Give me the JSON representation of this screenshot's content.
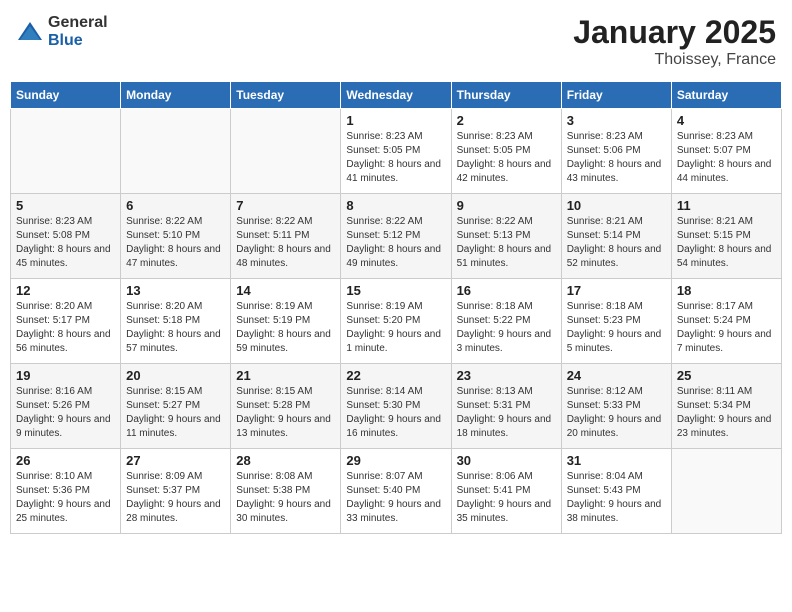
{
  "logo": {
    "general": "General",
    "blue": "Blue"
  },
  "header": {
    "month": "January 2025",
    "location": "Thoissey, France"
  },
  "weekdays": [
    "Sunday",
    "Monday",
    "Tuesday",
    "Wednesday",
    "Thursday",
    "Friday",
    "Saturday"
  ],
  "weeks": [
    [
      {
        "day": "",
        "info": ""
      },
      {
        "day": "",
        "info": ""
      },
      {
        "day": "",
        "info": ""
      },
      {
        "day": "1",
        "info": "Sunrise: 8:23 AM\nSunset: 5:05 PM\nDaylight: 8 hours and 41 minutes."
      },
      {
        "day": "2",
        "info": "Sunrise: 8:23 AM\nSunset: 5:05 PM\nDaylight: 8 hours and 42 minutes."
      },
      {
        "day": "3",
        "info": "Sunrise: 8:23 AM\nSunset: 5:06 PM\nDaylight: 8 hours and 43 minutes."
      },
      {
        "day": "4",
        "info": "Sunrise: 8:23 AM\nSunset: 5:07 PM\nDaylight: 8 hours and 44 minutes."
      }
    ],
    [
      {
        "day": "5",
        "info": "Sunrise: 8:23 AM\nSunset: 5:08 PM\nDaylight: 8 hours and 45 minutes."
      },
      {
        "day": "6",
        "info": "Sunrise: 8:22 AM\nSunset: 5:10 PM\nDaylight: 8 hours and 47 minutes."
      },
      {
        "day": "7",
        "info": "Sunrise: 8:22 AM\nSunset: 5:11 PM\nDaylight: 8 hours and 48 minutes."
      },
      {
        "day": "8",
        "info": "Sunrise: 8:22 AM\nSunset: 5:12 PM\nDaylight: 8 hours and 49 minutes."
      },
      {
        "day": "9",
        "info": "Sunrise: 8:22 AM\nSunset: 5:13 PM\nDaylight: 8 hours and 51 minutes."
      },
      {
        "day": "10",
        "info": "Sunrise: 8:21 AM\nSunset: 5:14 PM\nDaylight: 8 hours and 52 minutes."
      },
      {
        "day": "11",
        "info": "Sunrise: 8:21 AM\nSunset: 5:15 PM\nDaylight: 8 hours and 54 minutes."
      }
    ],
    [
      {
        "day": "12",
        "info": "Sunrise: 8:20 AM\nSunset: 5:17 PM\nDaylight: 8 hours and 56 minutes."
      },
      {
        "day": "13",
        "info": "Sunrise: 8:20 AM\nSunset: 5:18 PM\nDaylight: 8 hours and 57 minutes."
      },
      {
        "day": "14",
        "info": "Sunrise: 8:19 AM\nSunset: 5:19 PM\nDaylight: 8 hours and 59 minutes."
      },
      {
        "day": "15",
        "info": "Sunrise: 8:19 AM\nSunset: 5:20 PM\nDaylight: 9 hours and 1 minute."
      },
      {
        "day": "16",
        "info": "Sunrise: 8:18 AM\nSunset: 5:22 PM\nDaylight: 9 hours and 3 minutes."
      },
      {
        "day": "17",
        "info": "Sunrise: 8:18 AM\nSunset: 5:23 PM\nDaylight: 9 hours and 5 minutes."
      },
      {
        "day": "18",
        "info": "Sunrise: 8:17 AM\nSunset: 5:24 PM\nDaylight: 9 hours and 7 minutes."
      }
    ],
    [
      {
        "day": "19",
        "info": "Sunrise: 8:16 AM\nSunset: 5:26 PM\nDaylight: 9 hours and 9 minutes."
      },
      {
        "day": "20",
        "info": "Sunrise: 8:15 AM\nSunset: 5:27 PM\nDaylight: 9 hours and 11 minutes."
      },
      {
        "day": "21",
        "info": "Sunrise: 8:15 AM\nSunset: 5:28 PM\nDaylight: 9 hours and 13 minutes."
      },
      {
        "day": "22",
        "info": "Sunrise: 8:14 AM\nSunset: 5:30 PM\nDaylight: 9 hours and 16 minutes."
      },
      {
        "day": "23",
        "info": "Sunrise: 8:13 AM\nSunset: 5:31 PM\nDaylight: 9 hours and 18 minutes."
      },
      {
        "day": "24",
        "info": "Sunrise: 8:12 AM\nSunset: 5:33 PM\nDaylight: 9 hours and 20 minutes."
      },
      {
        "day": "25",
        "info": "Sunrise: 8:11 AM\nSunset: 5:34 PM\nDaylight: 9 hours and 23 minutes."
      }
    ],
    [
      {
        "day": "26",
        "info": "Sunrise: 8:10 AM\nSunset: 5:36 PM\nDaylight: 9 hours and 25 minutes."
      },
      {
        "day": "27",
        "info": "Sunrise: 8:09 AM\nSunset: 5:37 PM\nDaylight: 9 hours and 28 minutes."
      },
      {
        "day": "28",
        "info": "Sunrise: 8:08 AM\nSunset: 5:38 PM\nDaylight: 9 hours and 30 minutes."
      },
      {
        "day": "29",
        "info": "Sunrise: 8:07 AM\nSunset: 5:40 PM\nDaylight: 9 hours and 33 minutes."
      },
      {
        "day": "30",
        "info": "Sunrise: 8:06 AM\nSunset: 5:41 PM\nDaylight: 9 hours and 35 minutes."
      },
      {
        "day": "31",
        "info": "Sunrise: 8:04 AM\nSunset: 5:43 PM\nDaylight: 9 hours and 38 minutes."
      },
      {
        "day": "",
        "info": ""
      }
    ]
  ]
}
